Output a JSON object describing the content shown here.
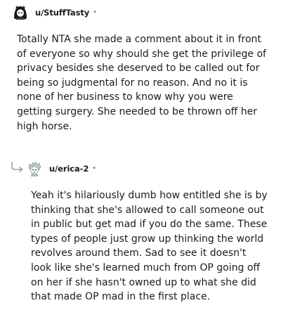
{
  "comments": [
    {
      "username": "u/StuffTasty",
      "separator": "•",
      "avatar_icon": "hooded-character-avatar-icon",
      "body": "Totally NTA she made a comment about it in front of everyone so why should she get the privilege of privacy besides she deserved to be called out for being so judgmental for no reason. And no it is none of her business to know why you were getting surgery. She needed to be thrown off her high horse."
    },
    {
      "username": "u/erica-2",
      "separator": "•",
      "avatar_icon": "spiky-hair-character-avatar-icon",
      "reply_icon": "reply-arrow-icon",
      "body": "Yeah it's hilariously dumb how entitled she is by thinking that she's allowed to call someone out in public but get mad if you do the same. These types of people just grow up thinking the world revolves around them. Sad to see it doesn't look like she's learned much from OP going off on her if she hasn't owned up to what she did that made OP mad in the first place."
    }
  ],
  "colors": {
    "text": "#1c1c1c",
    "meta": "#7c7c7c",
    "avatar_dark": "#1a1a1a",
    "avatar_accent": "#b9d8c8"
  }
}
